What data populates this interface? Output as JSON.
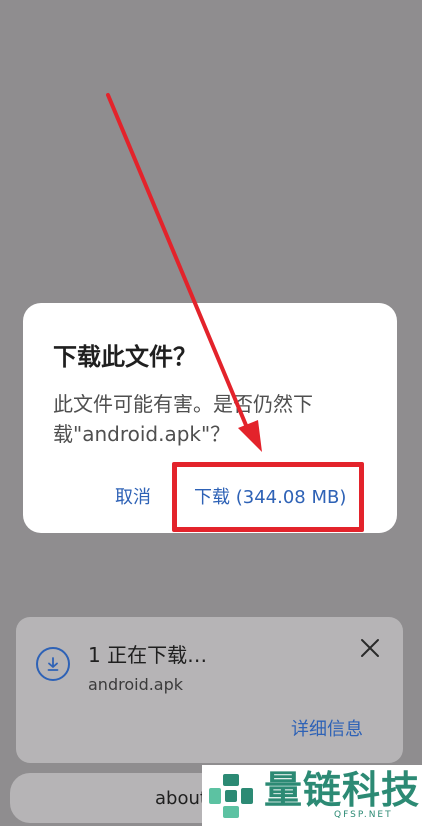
{
  "dialog": {
    "title": "下载此文件？",
    "message": "此文件可能有害。是否仍然下\n载\"android.apk\"？",
    "cancel_label": "取消",
    "download_label": "下载 (344.08 MB)"
  },
  "download_bar": {
    "title": "1 正在下载…",
    "filename": "android.apk",
    "details_label": "详细信息",
    "close_icon": "close-icon",
    "status_icon": "download-circle-icon"
  },
  "bottom": {
    "text": "about"
  },
  "watermark": {
    "name": "量链科技",
    "sub": "QFSP.NET"
  },
  "colors": {
    "accent": "#2e62b6",
    "overlay": "#8f8d8f",
    "highlight": "#e3232b",
    "watermark": "#2c8a74"
  }
}
